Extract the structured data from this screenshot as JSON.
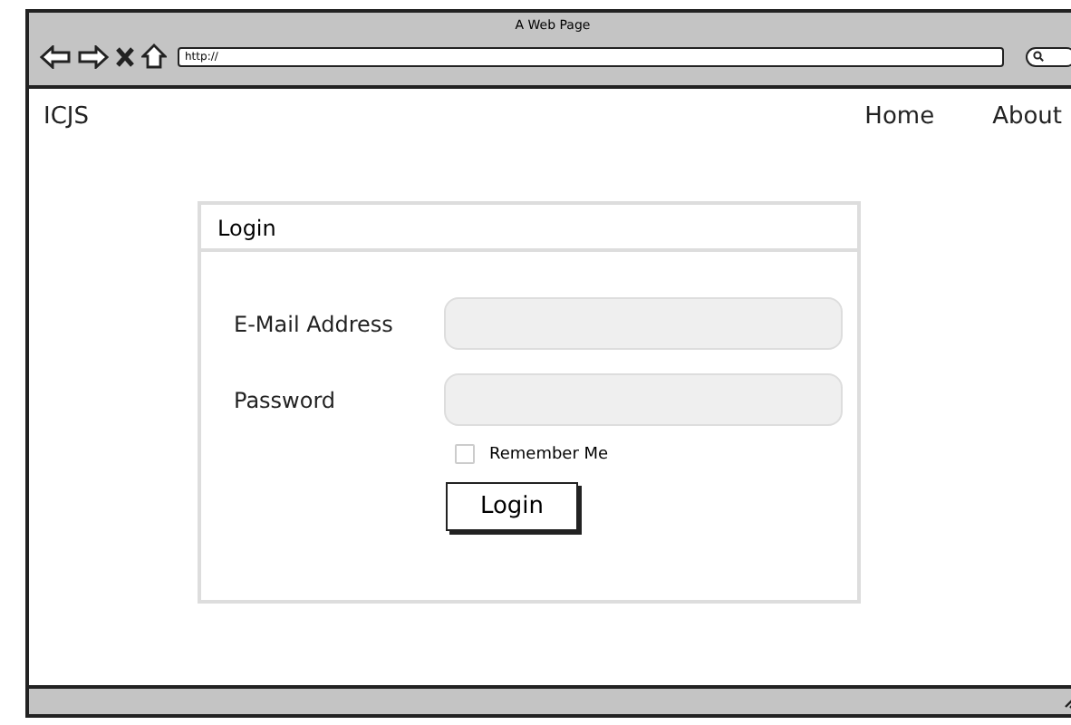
{
  "window": {
    "title": "A Web Page",
    "address": "http://"
  },
  "nav": {
    "brand": "ICJS",
    "links": [
      "Home",
      "About"
    ]
  },
  "login": {
    "title": "Login",
    "fields": [
      {
        "label": "E-Mail Address"
      },
      {
        "label": "Password"
      }
    ],
    "remember": {
      "label": "Remember Me",
      "checked": false
    },
    "button": "Login"
  }
}
